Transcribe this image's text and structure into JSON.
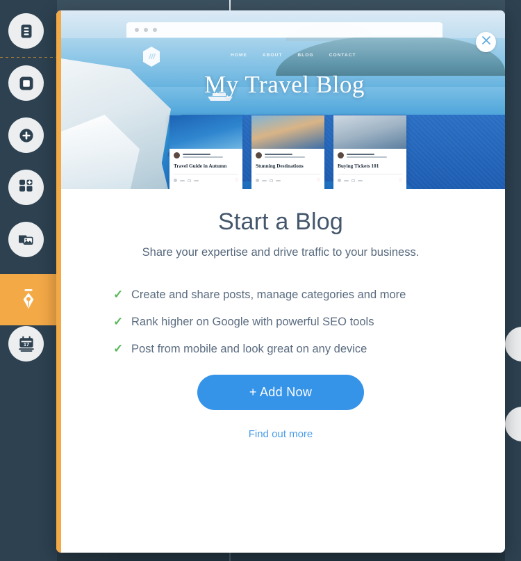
{
  "sidebar": {
    "items": [
      {
        "name": "pages",
        "icon": "document-icon",
        "active": false
      },
      {
        "name": "shape",
        "icon": "square-shape-icon",
        "active": false
      },
      {
        "name": "add",
        "icon": "plus-circle-icon",
        "active": false
      },
      {
        "name": "apps",
        "icon": "grid-add-icon",
        "active": false
      },
      {
        "name": "media",
        "icon": "image-gallery-icon",
        "active": false
      },
      {
        "name": "blog",
        "icon": "pen-nib-icon",
        "active": true
      },
      {
        "name": "bookings",
        "icon": "calendar-icon",
        "active": false
      }
    ],
    "calendar_day": "17",
    "active_color": "#f4a947"
  },
  "modal": {
    "close_label": "×",
    "accent_stripe_color": "#f4a947"
  },
  "hero": {
    "browser": {
      "dots": 3,
      "logo": "hexagon-logo-icon",
      "nav": [
        "HOME",
        "ABOUT",
        "BLOG",
        "CONTACT"
      ],
      "site_title": "My Travel Blog",
      "cards": [
        {
          "title": "Travel Guide in Autumn",
          "heart": "♡"
        },
        {
          "title": "Stunning Destinations",
          "heart": "♡"
        },
        {
          "title": "Buying Tickets 101",
          "heart": "♡"
        }
      ]
    }
  },
  "panel": {
    "title": "Start a Blog",
    "subtitle": "Share your expertise and drive traffic to your business.",
    "features": [
      {
        "check": "✓",
        "text": "Create and share posts, manage categories and more"
      },
      {
        "check": "✓",
        "text": "Rank higher on Google with powerful SEO tools"
      },
      {
        "check": "✓",
        "text": "Post from mobile and look great on any device"
      }
    ],
    "cta_label": "+  Add Now",
    "secondary_link": "Find out more",
    "cta_color": "#3593e8",
    "check_color": "#5cb85c"
  }
}
